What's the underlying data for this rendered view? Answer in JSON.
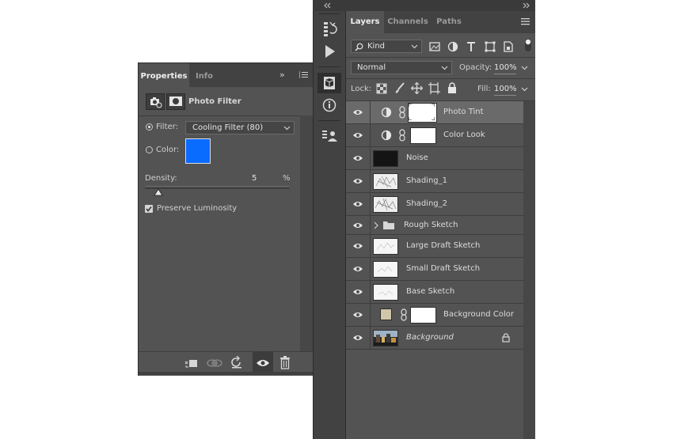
{
  "properties_panel": {
    "tabs": [
      {
        "label": "Properties",
        "active": true
      },
      {
        "label": "Info",
        "active": false
      }
    ],
    "collapse_glyph": "»",
    "title": "Photo Filter",
    "filter_option_label": "Filter:",
    "filter_value": "Cooling Filter (80)",
    "filter_selected": true,
    "color_option_label": "Color:",
    "color_value": "#0a6bff",
    "density_label": "Density:",
    "density_value": "5",
    "density_unit": "%",
    "density_percent": 5,
    "preserve_luminosity_label": "Preserve Luminosity",
    "preserve_luminosity_checked": true
  },
  "tool_strip": {
    "icons": [
      "history-icon",
      "play-action-icon",
      "3d-icon",
      "info-icon",
      "properties-icon"
    ]
  },
  "layers_panel": {
    "tabs": [
      {
        "label": "Layers",
        "active": true
      },
      {
        "label": "Channels",
        "active": false
      },
      {
        "label": "Paths",
        "active": false
      }
    ],
    "filter_kind_value": "Kind",
    "blend_mode_value": "Normal",
    "opacity_label": "Opacity:",
    "opacity_value": "100%",
    "lock_label": "Lock:",
    "fill_label": "Fill:",
    "fill_value": "100%",
    "layers": [
      {
        "name": "Photo Tint",
        "kind": "adjustment",
        "selected": true,
        "visible": true
      },
      {
        "name": "Color Look",
        "kind": "adjustment",
        "selected": false,
        "visible": true
      },
      {
        "name": "Noise",
        "kind": "dark-pixel",
        "selected": false,
        "visible": true
      },
      {
        "name": "Shading_1",
        "kind": "sketch",
        "selected": false,
        "visible": true
      },
      {
        "name": "Shading_2",
        "kind": "sketch",
        "selected": false,
        "visible": true
      },
      {
        "name": "Rough Sketch",
        "kind": "group",
        "selected": false,
        "visible": true
      },
      {
        "name": "Large Draft Sketch",
        "kind": "light-sketch",
        "selected": false,
        "visible": true
      },
      {
        "name": "Small Draft Sketch",
        "kind": "light-sketch",
        "selected": false,
        "visible": true
      },
      {
        "name": "Base Sketch",
        "kind": "light-sketch",
        "selected": false,
        "visible": true
      },
      {
        "name": "Background Color",
        "kind": "solid-fill",
        "selected": false,
        "visible": true
      },
      {
        "name": "Background",
        "kind": "background",
        "selected": false,
        "visible": true,
        "locked": true
      }
    ]
  },
  "colors": {
    "panel_bg": "#535353",
    "dark_bg": "#424242",
    "selected_row": "#6a6a6a",
    "swatch_blue": "#0a6bff",
    "fill_color_tan": "#d1c6a8"
  }
}
